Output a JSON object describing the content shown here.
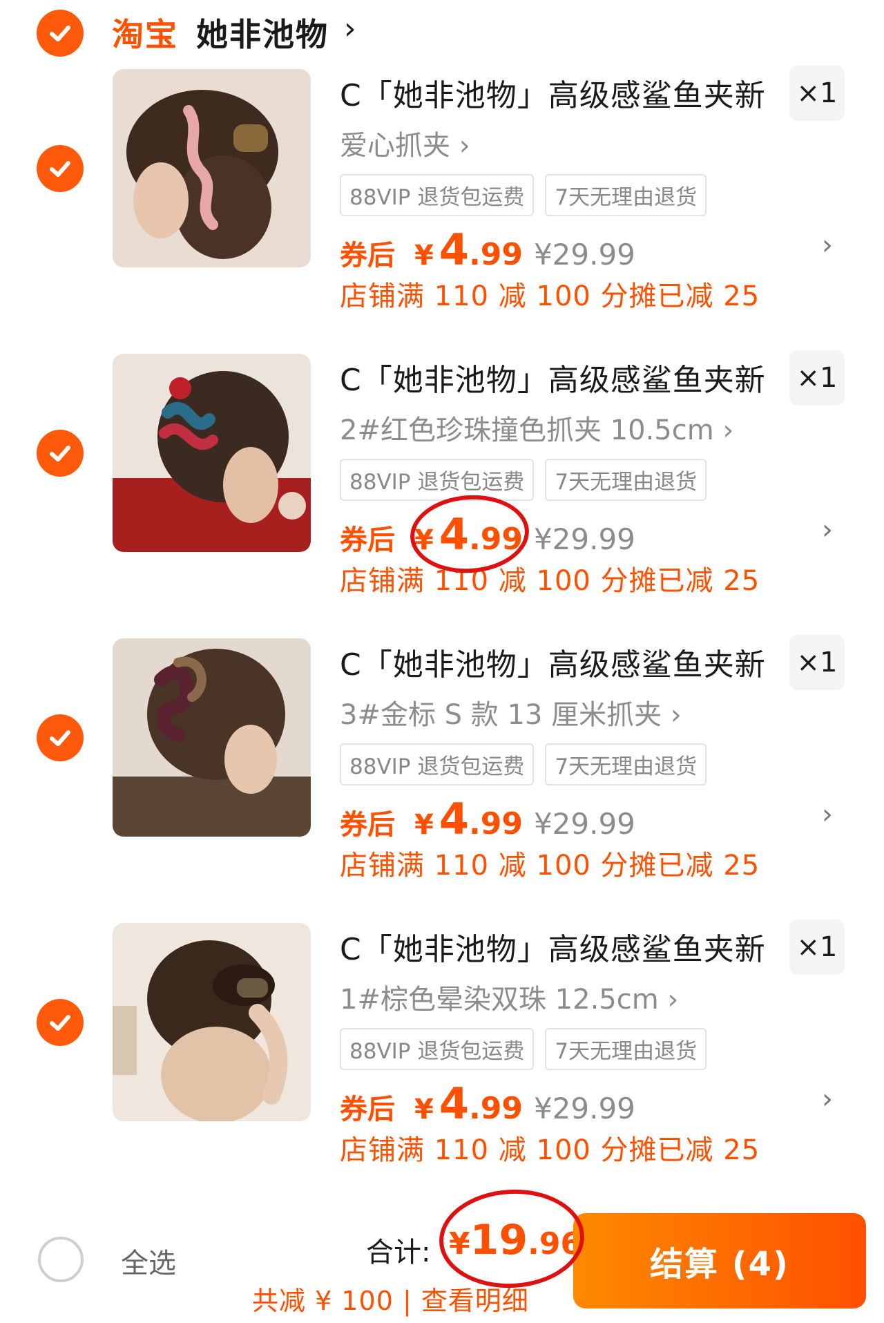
{
  "store": {
    "brand": "淘宝",
    "name": "她非池物",
    "chevron": "›"
  },
  "items": [
    {
      "title": "C「她非池物」高级感鲨鱼夹新",
      "variant": "爱心抓夹 ›",
      "qty": "×1",
      "tags": [
        "88VIP 退货包运费",
        "7天无理由退货"
      ],
      "coupon_label": "券后",
      "currency": "¥",
      "price_int": "4",
      "price_dec": ".99",
      "orig_price": "¥29.99",
      "promo": "店铺满 110 减 100 分摊已减 25"
    },
    {
      "title": "C「她非池物」高级感鲨鱼夹新",
      "variant": "2#红色珍珠撞色抓夹 10.5cm ›",
      "qty": "×1",
      "tags": [
        "88VIP 退货包运费",
        "7天无理由退货"
      ],
      "coupon_label": "券后",
      "currency": "¥",
      "price_int": "4",
      "price_dec": ".99",
      "orig_price": "¥29.99",
      "promo": "店铺满 110 减 100 分摊已减 25"
    },
    {
      "title": "C「她非池物」高级感鲨鱼夹新",
      "variant": "3#金标 S 款 13 厘米抓夹 ›",
      "qty": "×1",
      "tags": [
        "88VIP 退货包运费",
        "7天无理由退货"
      ],
      "coupon_label": "券后",
      "currency": "¥",
      "price_int": "4",
      "price_dec": ".99",
      "orig_price": "¥29.99",
      "promo": "店铺满 110 减 100 分摊已减 25"
    },
    {
      "title": "C「她非池物」高级感鲨鱼夹新",
      "variant": "1#棕色晕染双珠 12.5cm ›",
      "qty": "×1",
      "tags": [
        "88VIP 退货包运费",
        "7天无理由退货"
      ],
      "coupon_label": "券后",
      "currency": "¥",
      "price_int": "4",
      "price_dec": ".99",
      "orig_price": "¥29.99",
      "promo": "店铺满 110 减 100 分摊已减 25"
    }
  ],
  "footer": {
    "select_all": "全选",
    "total_label": "合计:",
    "total_currency": "¥",
    "total_int": "19",
    "total_dec": ".96",
    "saved": "共减 ¥ 100 | 查看明细",
    "checkout": "结算 (4)"
  },
  "colors": {
    "accent": "#ff5000",
    "check": "#ff5a0c",
    "annotation": "#e01010"
  },
  "icons": {
    "check": "check-icon",
    "row_chevron": "chevron-right-icon"
  }
}
